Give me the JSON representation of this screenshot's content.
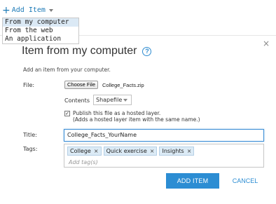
{
  "add_item": {
    "plus_icon": "plus-icon",
    "label": "Add Item",
    "caret_icon": "chevron-down-icon"
  },
  "dropdown": {
    "items": [
      {
        "label": "From my computer",
        "active": true
      },
      {
        "label": "From the web",
        "active": false
      },
      {
        "label": "An application",
        "active": false
      }
    ]
  },
  "dialog": {
    "title": "Item from my computer",
    "help_icon_glyph": "?",
    "close_glyph": "×",
    "instructions": "Add an item from your computer.",
    "file_label": "File:",
    "choose_file_label": "Choose File",
    "file_name": "College_Facts.zip",
    "contents_label": "Contents",
    "contents_value": "Shapefile",
    "publish_checked": true,
    "publish_line1": "Publish this file as a hosted layer.",
    "publish_line2": "(Adds a hosted layer item with the same name.)",
    "title_label": "Title:",
    "title_value": "College_Facts_YourName",
    "tags_label": "Tags:",
    "tags": [
      "College",
      "Quick exercise",
      "Insights"
    ],
    "tag_remove_glyph": "×",
    "tags_placeholder": "Add tag(s)",
    "add_button": "ADD ITEM",
    "cancel_button": "CANCEL"
  },
  "colors": {
    "accent": "#2c8dd3",
    "link": "#1b79b6",
    "tag_bg": "#dcebf6",
    "selected_row": "#dbe9f5"
  }
}
